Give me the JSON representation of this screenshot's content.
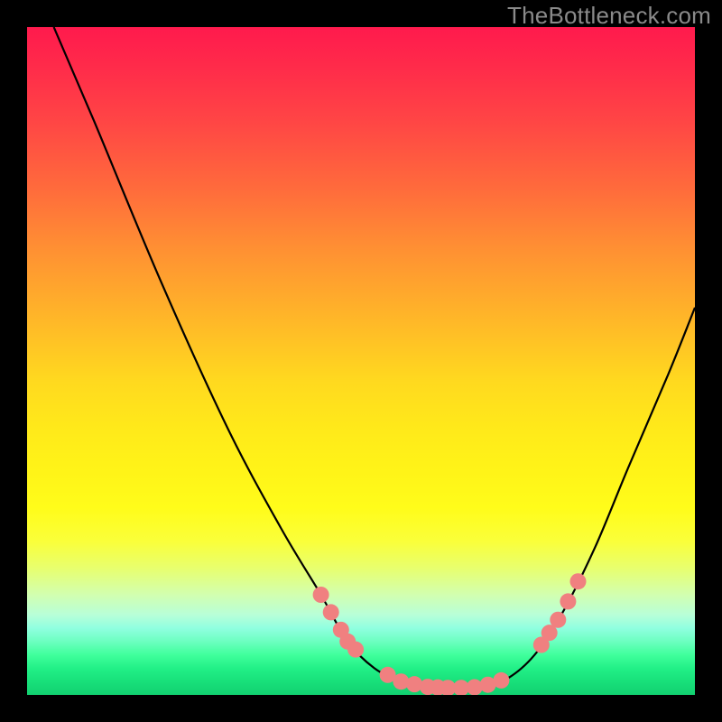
{
  "watermark": "TheBottleneck.com",
  "chart_data": {
    "type": "line",
    "title": "",
    "xlabel": "",
    "ylabel": "",
    "xlim": [
      0,
      100
    ],
    "ylim": [
      0,
      100
    ],
    "background_gradient": {
      "direction": "vertical",
      "stops": [
        {
          "pct": 0,
          "color": "#ff1a4d"
        },
        {
          "pct": 50,
          "color": "#ffd400"
        },
        {
          "pct": 80,
          "color": "#f5ff60"
        },
        {
          "pct": 92,
          "color": "#60ffb0"
        },
        {
          "pct": 100,
          "color": "#12d070"
        }
      ]
    },
    "series": [
      {
        "name": "curve",
        "color": "#000000",
        "points": [
          {
            "x": 4,
            "y": 100
          },
          {
            "x": 10,
            "y": 86
          },
          {
            "x": 20,
            "y": 62
          },
          {
            "x": 30,
            "y": 40
          },
          {
            "x": 38,
            "y": 25
          },
          {
            "x": 44,
            "y": 15
          },
          {
            "x": 48,
            "y": 8
          },
          {
            "x": 52,
            "y": 4
          },
          {
            "x": 56,
            "y": 2
          },
          {
            "x": 60,
            "y": 1.2
          },
          {
            "x": 64,
            "y": 1
          },
          {
            "x": 68,
            "y": 1.2
          },
          {
            "x": 72,
            "y": 2.5
          },
          {
            "x": 76,
            "y": 6
          },
          {
            "x": 80,
            "y": 12
          },
          {
            "x": 85,
            "y": 22
          },
          {
            "x": 90,
            "y": 34
          },
          {
            "x": 96,
            "y": 48
          },
          {
            "x": 100,
            "y": 58
          }
        ]
      }
    ],
    "markers": {
      "color": "#f08080",
      "radius": 9,
      "x_values_left_cluster": [
        44,
        45.5,
        47,
        48,
        49.2
      ],
      "x_values_bottom_cluster": [
        54,
        56,
        58,
        60,
        61.5,
        63,
        65,
        67,
        69,
        71
      ],
      "x_values_right_cluster": [
        77,
        78.2,
        79.5,
        81,
        82.5
      ]
    }
  }
}
